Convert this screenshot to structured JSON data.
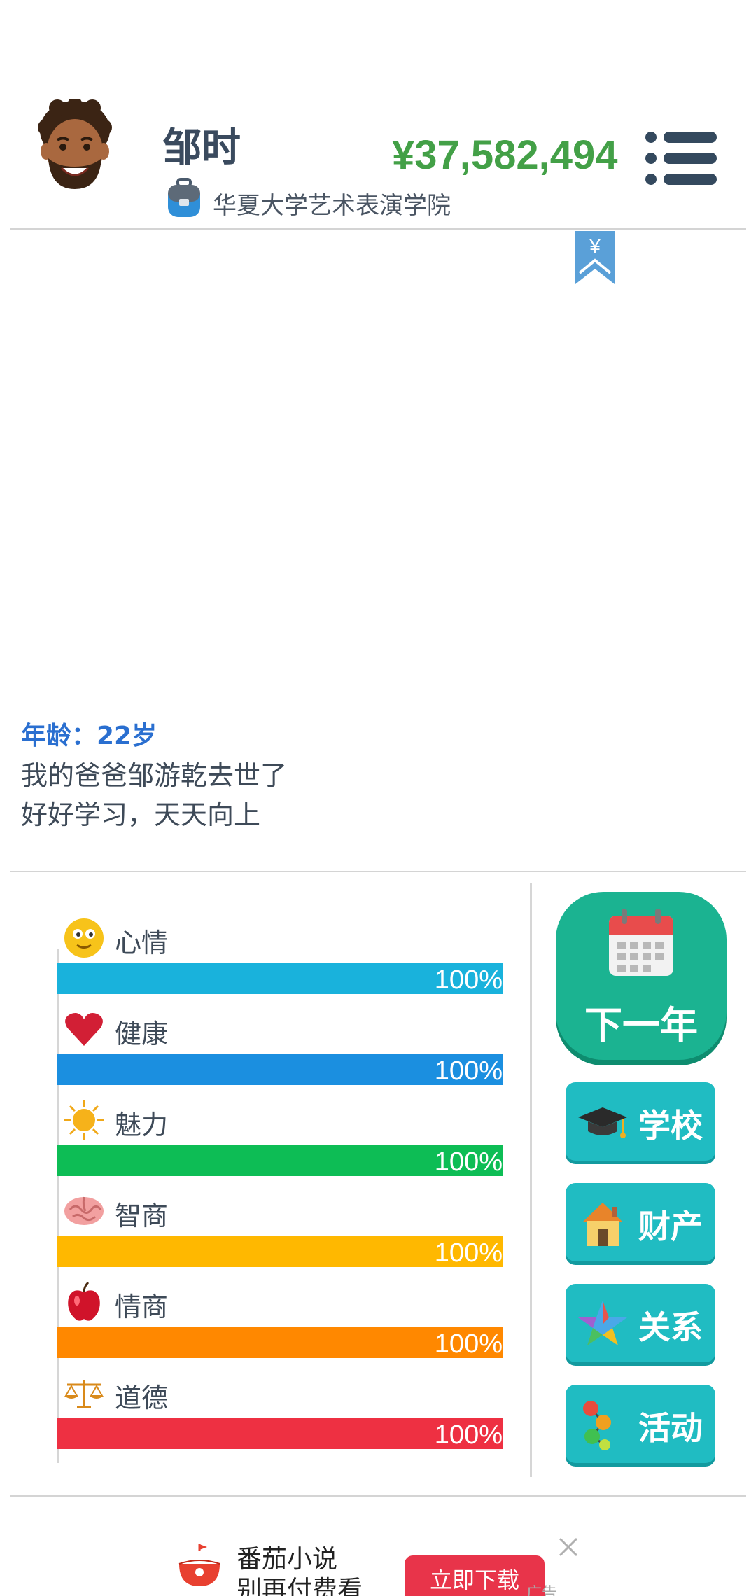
{
  "profile": {
    "name": "邹时",
    "school": "华夏大学艺术表演学院",
    "money": "¥37,582,494"
  },
  "bookmark": {
    "label": "¥"
  },
  "log": {
    "age": "年龄：22岁",
    "lines": [
      "我的爸爸邹游乾去世了",
      "好好学习，天天向上"
    ]
  },
  "stats": [
    {
      "label": "心情",
      "percent": "100%",
      "value": 1.0,
      "color": "#19b2dc",
      "icon": "smiley-face-icon"
    },
    {
      "label": "健康",
      "percent": "100%",
      "value": 1.0,
      "color": "#1b8fe0",
      "icon": "heart-icon"
    },
    {
      "label": "魅力",
      "percent": "100%",
      "value": 1.0,
      "color": "#0dbd55",
      "icon": "sun-icon"
    },
    {
      "label": "智商",
      "percent": "100%",
      "value": 1.0,
      "color": "#ffb800",
      "icon": "brain-icon"
    },
    {
      "label": "情商",
      "percent": "100%",
      "value": 1.0,
      "color": "#ff8800",
      "icon": "apple-icon"
    },
    {
      "label": "道德",
      "percent": "100%",
      "value": 1.0,
      "color": "#ee3042",
      "icon": "scales-icon"
    }
  ],
  "actions": {
    "next_year": "下一年",
    "school": "学校",
    "property": "财产",
    "relations": "关系",
    "activities": "活动"
  },
  "ad": {
    "title": "番茄小说",
    "subtitle": "别再付费看",
    "download": "立即下载",
    "tag": "广告"
  }
}
